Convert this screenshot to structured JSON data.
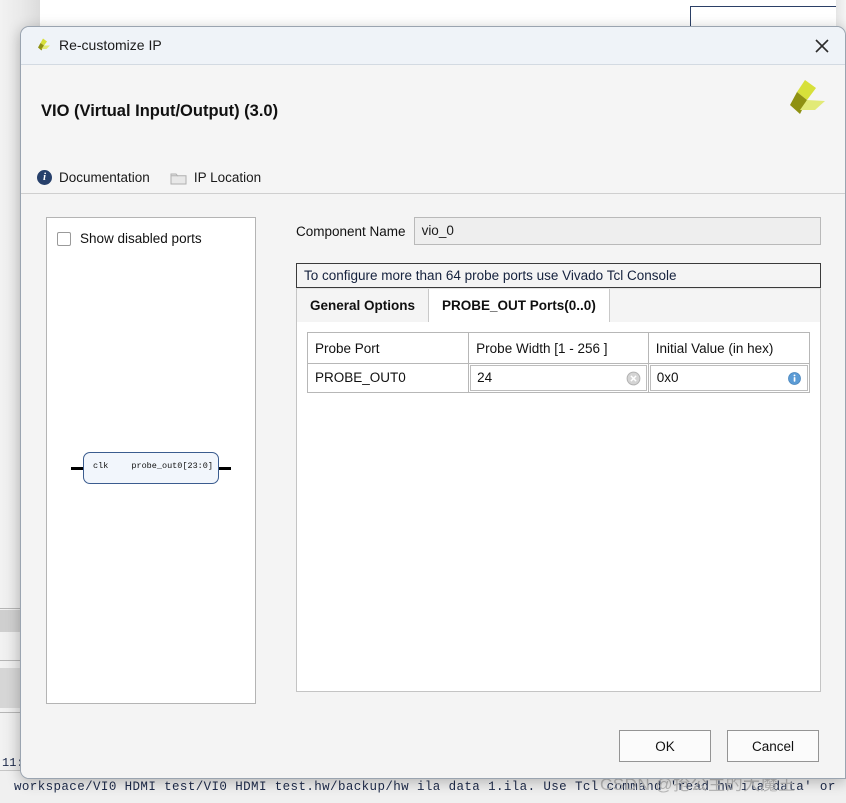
{
  "background": {
    "console_prefix": "11:",
    "status_text": "workspace/VI0 HDMI test/VI0 HDMI test.hw/backup/hw ila data 1.ila. Use Tcl command 'read hw ila data' or",
    "watermark": "CSDN @抢公主的大魔王"
  },
  "dialog": {
    "titlebar": {
      "title": "Re-customize IP",
      "logo_icon": "xilinx-logo-icon",
      "close_icon": "close-icon"
    },
    "header": {
      "ip_title": "VIO (Virtual Input/Output) (3.0)",
      "brand_logo_icon": "xilinx-logo-icon",
      "links": [
        {
          "label": "Documentation",
          "icon": "info-circle-icon"
        },
        {
          "label": "IP Location",
          "icon": "folder-icon"
        }
      ]
    },
    "left_panel": {
      "show_disabled_ports": {
        "label": "Show disabled ports",
        "checked": false
      },
      "ip_block": {
        "input_port": "clk",
        "output_port": "probe_out0[23:0]"
      }
    },
    "config": {
      "component_name_label": "Component Name",
      "component_name_value": "vio_0",
      "notice": "To configure more than 64 probe ports use Vivado Tcl Console",
      "tabs": [
        {
          "label": "General Options",
          "active": false
        },
        {
          "label": "PROBE_OUT Ports(0..0)",
          "active": true
        }
      ],
      "table": {
        "headers": [
          "Probe Port",
          "Probe Width [1 - 256 ]",
          "Initial Value (in hex)"
        ],
        "rows": [
          {
            "probe_port": "PROBE_OUT0",
            "probe_width": "24",
            "initial_value": "0x0",
            "clear_icon": "clear-circle-icon",
            "info_icon": "info-circle-icon"
          }
        ]
      }
    },
    "footer": {
      "ok_label": "OK",
      "cancel_label": "Cancel"
    }
  },
  "colors": {
    "brand_olive": "#8f9112",
    "brand_lime": "#d7e03a",
    "dialog_bg": "#f4f4f4",
    "titlebar_bg": "#eff3f8",
    "accent_blue": "#5b9bd5"
  }
}
